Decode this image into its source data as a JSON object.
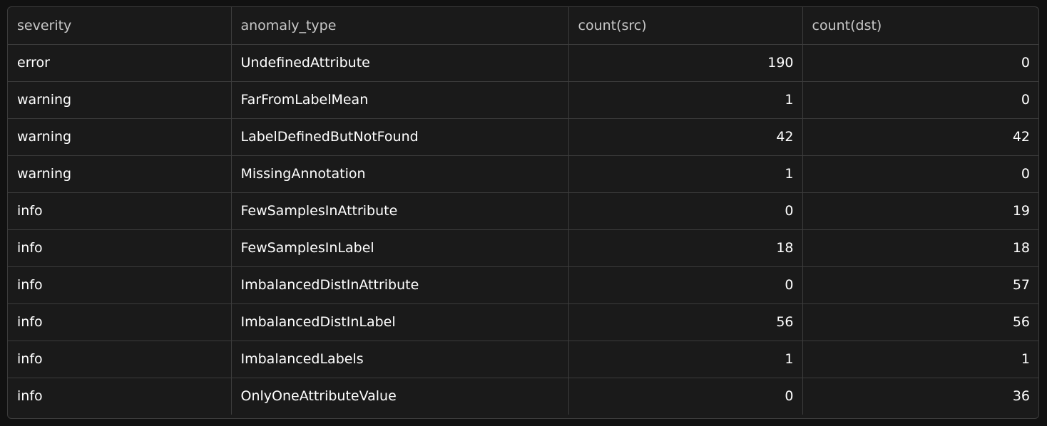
{
  "table": {
    "columns": [
      "severity",
      "anomaly_type",
      "count(src)",
      "count(dst)"
    ],
    "rows": [
      {
        "severity": "error",
        "anomaly_type": "UndefinedAttribute",
        "count_src": "190",
        "count_dst": "0"
      },
      {
        "severity": "warning",
        "anomaly_type": "FarFromLabelMean",
        "count_src": "1",
        "count_dst": "0"
      },
      {
        "severity": "warning",
        "anomaly_type": "LabelDefinedButNotFound",
        "count_src": "42",
        "count_dst": "42"
      },
      {
        "severity": "warning",
        "anomaly_type": "MissingAnnotation",
        "count_src": "1",
        "count_dst": "0"
      },
      {
        "severity": "info",
        "anomaly_type": "FewSamplesInAttribute",
        "count_src": "0",
        "count_dst": "19"
      },
      {
        "severity": "info",
        "anomaly_type": "FewSamplesInLabel",
        "count_src": "18",
        "count_dst": "18"
      },
      {
        "severity": "info",
        "anomaly_type": "ImbalancedDistInAttribute",
        "count_src": "0",
        "count_dst": "57"
      },
      {
        "severity": "info",
        "anomaly_type": "ImbalancedDistInLabel",
        "count_src": "56",
        "count_dst": "56"
      },
      {
        "severity": "info",
        "anomaly_type": "ImbalancedLabels",
        "count_src": "1",
        "count_dst": "1"
      },
      {
        "severity": "info",
        "anomaly_type": "OnlyOneAttributeValue",
        "count_src": "0",
        "count_dst": "36"
      }
    ]
  },
  "colors": {
    "background": "#111111",
    "table_background": "#1a1a1a",
    "border": "#3c3c3c",
    "header_text": "#c9c9c9",
    "cell_text": "#ffffff"
  }
}
